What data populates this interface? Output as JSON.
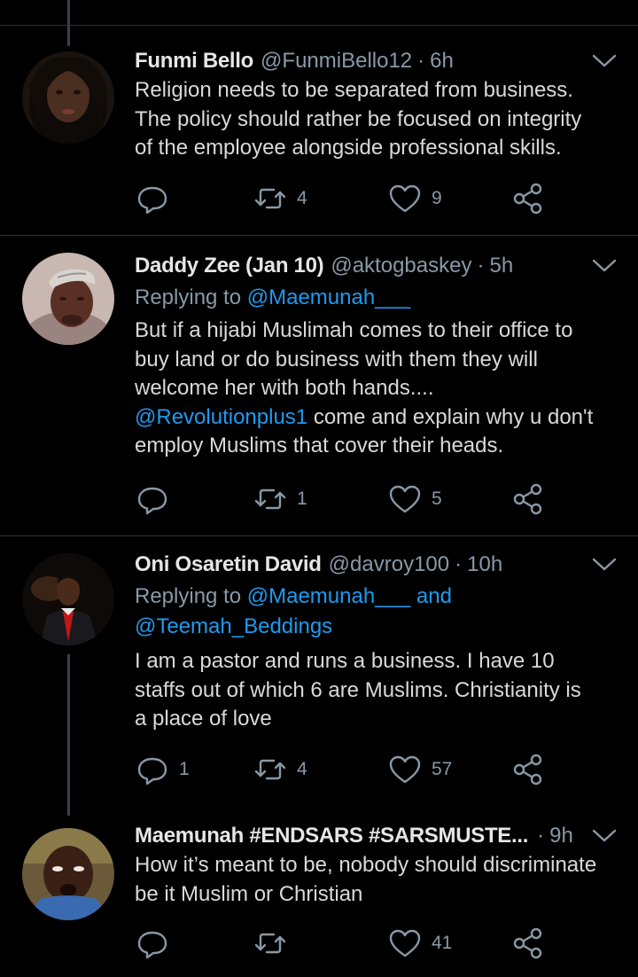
{
  "tweets": [
    {
      "name": "Funmi Bello",
      "handle": "@FunmiBello12",
      "time": "6h",
      "replying_to": null,
      "body_lines": [
        "Religion needs to be separated from business.",
        "The policy should rather be focused on integrity",
        "of the employee alongside professional skills."
      ],
      "reply_count": "",
      "retweet_count": "4",
      "like_count": "9",
      "avatar_icon": "avatar-photo"
    },
    {
      "name": "Daddy Zee (Jan 10)",
      "handle": "@aktogbaskey",
      "time": "5h",
      "replying_to_prefix": "Replying to ",
      "replying_to_mention": "@Maemunah___",
      "body_lines": [
        "But if a hijabi Muslimah comes to their office to",
        "buy land or do business with them they will",
        "welcome her with both hands....",
        "come and explain why u don't",
        "employ Muslims that cover their heads."
      ],
      "body_mention": "@Revolutionplus1",
      "reply_count": "",
      "retweet_count": "1",
      "like_count": "5",
      "avatar_icon": "avatar-photo"
    },
    {
      "name": "Oni Osaretin David",
      "handle": "@davroy100",
      "time": "10h",
      "replying_to_prefix": "Replying to ",
      "replying_to_mention": "@Maemunah___",
      "replying_to_and": " and",
      "replying_to_mention2": "@Teemah_Beddings",
      "body_lines": [
        "I am a pastor and runs a business. I have 10",
        "staffs out of which 6 are Muslims. Christianity is",
        "a place of love"
      ],
      "reply_count": "1",
      "retweet_count": "4",
      "like_count": "57",
      "avatar_icon": "avatar-photo"
    },
    {
      "name": "Maemunah #ENDSARS #SARSMUSTE...",
      "handle": "",
      "time": "9h",
      "body_lines": [
        "How it’s meant to be, nobody should discriminate",
        "be it Muslim or Christian"
      ],
      "reply_count": "",
      "retweet_count": "",
      "like_count": "41",
      "avatar_icon": "avatar-photo"
    }
  ],
  "separator_dot": "·",
  "colors": {
    "background": "#000000",
    "text": "#d9d9d9",
    "muted": "#8899a6",
    "link": "#1d9bf0",
    "divider": "#2f3336"
  }
}
